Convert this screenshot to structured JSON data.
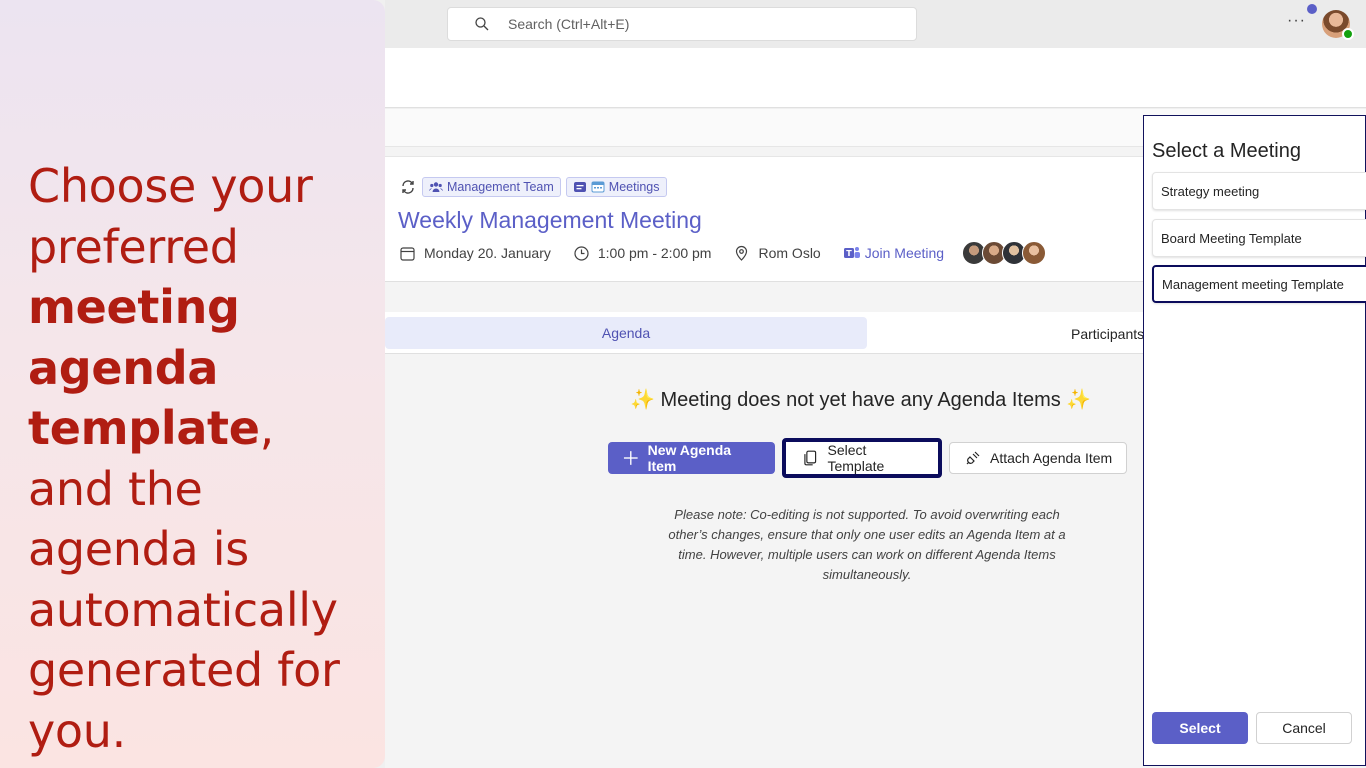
{
  "promo": {
    "line_prefix": "Choose your preferred",
    "bold_text": "meeting agenda template",
    "line_suffix": ", and the agenda is automatically generated for you."
  },
  "topbar": {
    "search_placeholder": "Search (Ctrl+Alt+E)",
    "more_label": "···"
  },
  "meeting": {
    "team_chip": "Management Team",
    "channel_chip": "Meetings",
    "title": "Weekly Management Meeting",
    "date": "Monday 20. January",
    "time": "1:00 pm - 2:00 pm",
    "location": "Rom Oslo",
    "join_label": "Join Meeting"
  },
  "tabs": {
    "agenda": "Agenda",
    "participants": "Participants"
  },
  "empty_state": {
    "title": "✨ Meeting does not yet have any Agenda Items ✨",
    "new_item": "New Agenda Item",
    "select_template": "Select Template",
    "attach_item": "Attach Agenda Item",
    "note": "Please note: Co-editing is not supported. To avoid overwriting each other’s changes, ensure that only one user edits an Agenda Item at a time. However, multiple users can work on different Agenda Items simultaneously."
  },
  "dialog": {
    "title": "Select a Meeting",
    "options": [
      "Strategy meeting",
      "Board Meeting Template",
      "Management meeting Template"
    ],
    "select": "Select",
    "cancel": "Cancel"
  },
  "colors": {
    "brand": "#5b5fc7",
    "promo_text": "#b01d12",
    "focus_border": "#0b0c5c"
  }
}
